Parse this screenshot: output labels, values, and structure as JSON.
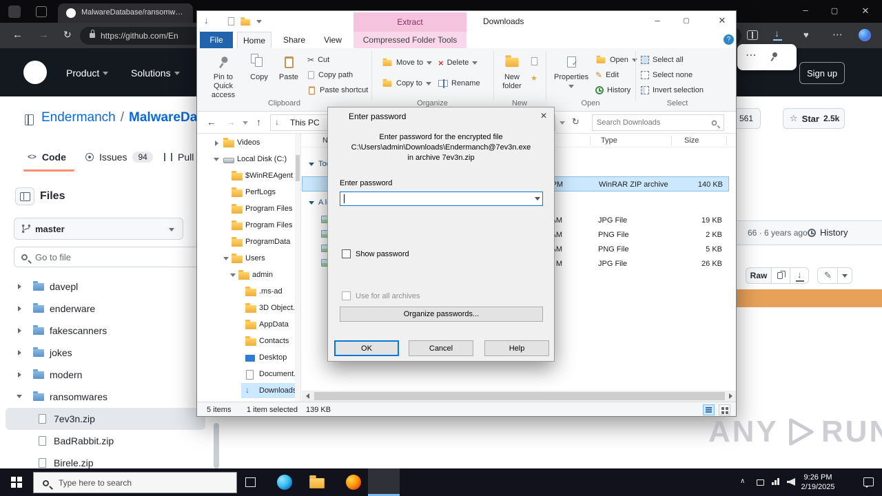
{
  "browser": {
    "tab_title": "MalwareDatabase/ransomware...",
    "url": "https://github.com/En"
  },
  "github": {
    "nav": {
      "product": "Product",
      "solutions": "Solutions",
      "signup": "Sign up"
    },
    "repo": {
      "owner": "Endermanch",
      "separator": "/",
      "name": "MalwareDa..."
    },
    "tabs": {
      "code": "Code",
      "issues": "Issues",
      "issues_count": "94",
      "pulls": "Pull requests"
    },
    "sidebar": {
      "files_title": "Files",
      "branch": "master",
      "goto_placeholder": "Go to file",
      "tree": [
        {
          "name": "davepl",
          "type": "folder"
        },
        {
          "name": "enderware",
          "type": "folder"
        },
        {
          "name": "fakescanners",
          "type": "folder"
        },
        {
          "name": "jokes",
          "type": "folder"
        },
        {
          "name": "modern",
          "type": "folder"
        },
        {
          "name": "ransomwares",
          "type": "folder-open"
        },
        {
          "name": "7ev3n.zip",
          "type": "file"
        },
        {
          "name": "BadRabbit.zip",
          "type": "file"
        },
        {
          "name": "Birele.zip",
          "type": "file"
        }
      ]
    },
    "aside": {
      "fork_count": "561",
      "star_label": "Star",
      "star_count": "2.5k",
      "commit_meta": "66 · 6 years ago",
      "history_label": "History",
      "raw_label": "Raw"
    }
  },
  "explorer": {
    "titlebar": {
      "contextual": "Extract",
      "title": "Downloads"
    },
    "tabs": {
      "file": "File",
      "home": "Home",
      "share": "Share",
      "view": "View",
      "tools": "Compressed Folder Tools"
    },
    "ribbon": {
      "pin_line1": "Pin to Quick",
      "pin_line2": "access",
      "copy": "Copy",
      "paste": "Paste",
      "cut": "Cut",
      "copy_path": "Copy path",
      "paste_shortcut": "Paste shortcut",
      "move_to": "Move to",
      "copy_to": "Copy to",
      "delete": "Delete",
      "rename": "Rename",
      "new_line1": "New",
      "new_line2": "folder",
      "properties": "Properties",
      "open": "Open",
      "edit": "Edit",
      "history": "History",
      "select_all": "Select all",
      "select_none": "Select none",
      "invert_selection": "Invert selection",
      "group_clipboard": "Clipboard",
      "group_organize": "Organize",
      "group_new": "New",
      "group_open": "Open",
      "group_select": "Select"
    },
    "address": {
      "location": "This PC",
      "search_placeholder": "Search Downloads"
    },
    "tree": [
      {
        "label": "Videos"
      },
      {
        "label": "Local Disk (C:)"
      },
      {
        "label": "$WinREAgent"
      },
      {
        "label": "PerfLogs"
      },
      {
        "label": "Program Files"
      },
      {
        "label": "Program Files"
      },
      {
        "label": "ProgramData"
      },
      {
        "label": "Users"
      },
      {
        "label": "admin"
      },
      {
        "label": ".ms-ad"
      },
      {
        "label": "3D Object..."
      },
      {
        "label": "AppData"
      },
      {
        "label": "Contacts"
      },
      {
        "label": "Desktop"
      },
      {
        "label": "Document..."
      },
      {
        "label": "Downloads"
      }
    ],
    "list": {
      "columns": {
        "name": "Name",
        "type": "Type",
        "size": "Size"
      },
      "groups": {
        "today": "Today",
        "older": "A long time ago"
      },
      "rows": [
        {
          "time": "PM",
          "type": "WinRAR ZIP archive",
          "size": "140 KB"
        },
        {
          "time": "AM",
          "type": "JPG File",
          "size": "19 KB"
        },
        {
          "time": "AM",
          "type": "PNG File",
          "size": "2 KB"
        },
        {
          "time": "AM",
          "type": "PNG File",
          "size": "5 KB"
        },
        {
          "time": "M",
          "type": "JPG File",
          "size": "26 KB"
        }
      ]
    },
    "status": {
      "items": "5 items",
      "selection": "1 item selected",
      "selection_size": "139 KB"
    }
  },
  "dialog": {
    "title": "Enter password",
    "message_line1": "Enter password for the encrypted file",
    "message_line2": "C:\\Users\\admin\\Downloads\\Endermanch@7ev3n.exe",
    "message_line3": "in archive 7ev3n.zip",
    "input_label": "Enter password",
    "show_password": "Show password",
    "use_for_all": "Use for all archives",
    "organize": "Organize passwords...",
    "ok": "OK",
    "cancel": "Cancel",
    "help": "Help"
  },
  "taskbar": {
    "search_placeholder": "Type here to search",
    "time": "9:26 PM",
    "date": "2/19/2025"
  },
  "watermark": {
    "left": "ANY",
    "right": "RUN"
  }
}
